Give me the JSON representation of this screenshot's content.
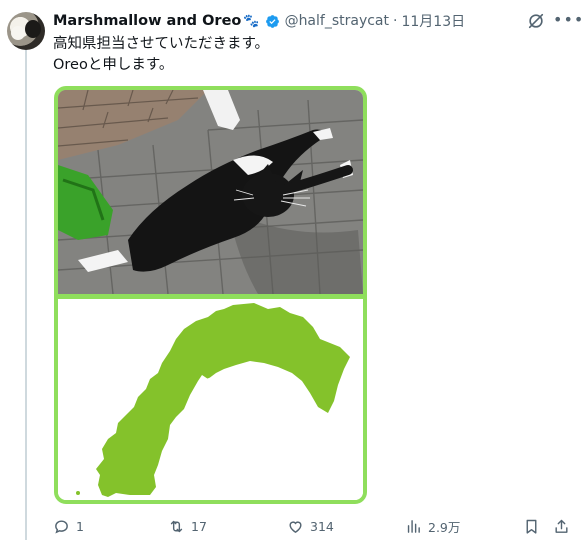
{
  "post": {
    "display_name": "Marshmallow and Oreo",
    "name_emoji": "🐾",
    "handle": "@half_straycat",
    "separator": "·",
    "date": "11月13日",
    "text_line1": "高知県担当させていただきます。",
    "text_line2": "Oreoと申します。"
  },
  "media": {
    "photo_icon": "cat-on-pavement-photo",
    "map_icon": "kochi-prefecture-map",
    "frame_color": "#8fde5c",
    "map_color": "#84c22b"
  },
  "actions": {
    "reply_count": "1",
    "repost_count": "17",
    "like_count": "314",
    "views_count": "2.9万"
  },
  "colors": {
    "verified": "#1d9bf0",
    "muted_text": "#536471",
    "text": "#0f1419"
  }
}
